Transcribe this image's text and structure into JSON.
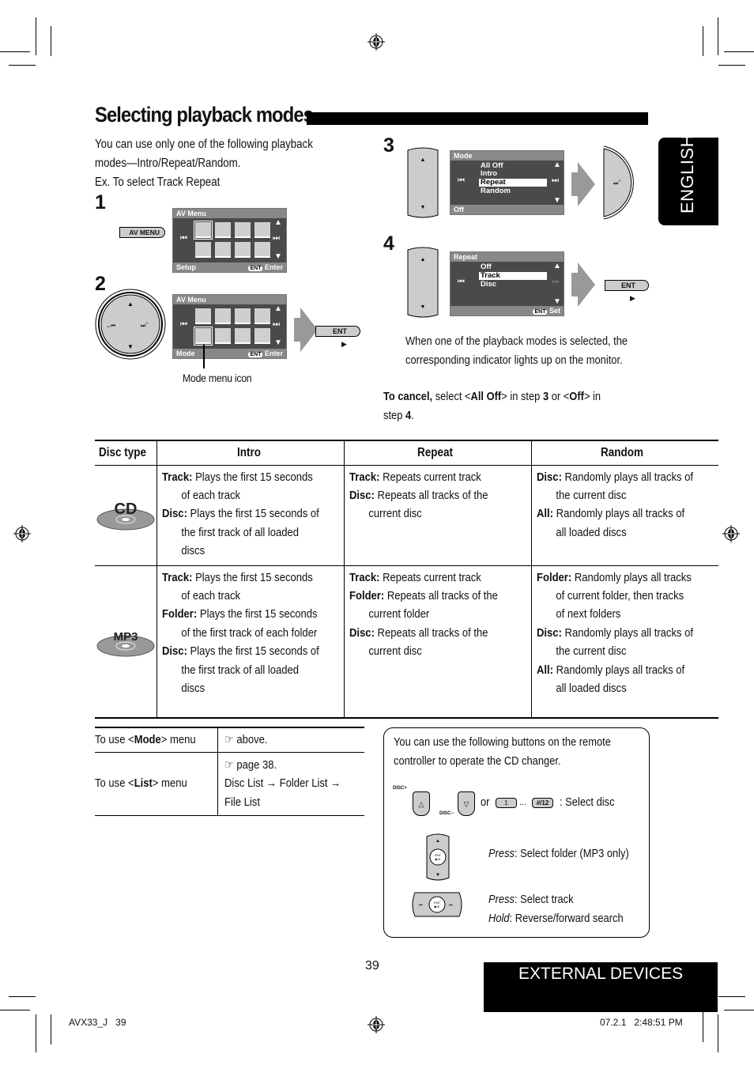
{
  "page": {
    "title": "Selecting playback modes",
    "intro_lines": [
      "You can use only one of the following playback",
      "modes—Intro/Repeat/Random.",
      "Ex. To select Track Repeat"
    ],
    "language_tab": "ENGLISH",
    "section_tab": "EXTERNAL DEVICES",
    "page_number": "39",
    "footer_left": "AVX33_J   39",
    "footer_right": "07.2.1   2:48:51 PM"
  },
  "steps": {
    "step1": {
      "number": "1",
      "button_label": "AV MENU",
      "screen": {
        "header": "AV Menu",
        "footer_left": "Setup",
        "footer_ent": "ENT",
        "footer_right": "Enter"
      }
    },
    "step2": {
      "number": "2",
      "screen": {
        "header": "AV Menu",
        "footer_left": "Mode",
        "footer_ent": "ENT",
        "footer_right": "Enter"
      },
      "button_label": "ENT",
      "callout": "Mode menu icon"
    },
    "step3": {
      "number": "3",
      "screen": {
        "header": "Mode",
        "items": [
          "All Off",
          "Intro",
          "Repeat",
          "Random"
        ],
        "selected": "Repeat",
        "footer_left": "Off"
      }
    },
    "step4": {
      "number": "4",
      "screen": {
        "header": "Repeat",
        "items": [
          "Off",
          "Track",
          "Disc"
        ],
        "selected": "Track",
        "footer_ent": "ENT",
        "footer_right": "Set"
      },
      "button_label": "ENT"
    },
    "note_lines": [
      "When one of the playback modes is selected, the",
      "corresponding indicator lights up on the monitor."
    ],
    "cancel": {
      "bold": "To cancel,",
      "t1": " select <",
      "b1": "All Off",
      "t2": "> in step ",
      "b2": "3",
      "t3": " or <",
      "b3": "Off",
      "t4": "> in",
      "t5": "step ",
      "b4": "4",
      "t6": "."
    }
  },
  "modes_table": {
    "headers": [
      "Disc type",
      "Intro",
      "Repeat",
      "Random"
    ],
    "rows": [
      {
        "disc": "CD",
        "intro": [
          {
            "k": "Track:",
            "v": " Plays the first 15 seconds of each track"
          },
          {
            "k": "Disc:",
            "v": " Plays the first 15 seconds of the first track of all loaded discs"
          }
        ],
        "repeat": [
          {
            "k": "Track:",
            "v": " Repeats current track"
          },
          {
            "k": "Disc:",
            "v": " Repeats all tracks of the current disc"
          }
        ],
        "random": [
          {
            "k": "Disc:",
            "v": " Randomly plays all tracks of the current disc"
          },
          {
            "k": "All:",
            "v": " Randomly plays all tracks of all loaded discs"
          }
        ]
      },
      {
        "disc": "MP3",
        "intro": [
          {
            "k": "Track:",
            "v": " Plays the first 15 seconds of each track"
          },
          {
            "k": "Folder:",
            "v": " Plays the first 15 seconds of the first track of each folder"
          },
          {
            "k": "Disc:",
            "v": " Plays the first 15 seconds of the first track of all loaded discs"
          }
        ],
        "repeat": [
          {
            "k": "Track:",
            "v": " Repeats current track"
          },
          {
            "k": "Folder:",
            "v": " Repeats all tracks of the current folder"
          },
          {
            "k": "Disc:",
            "v": " Repeats all tracks of the current disc"
          }
        ],
        "random": [
          {
            "k": "Folder:",
            "v": " Randomly plays all tracks of current folder, then tracks of next folders"
          },
          {
            "k": "Disc:",
            "v": " Randomly plays all tracks of the current disc"
          },
          {
            "k": "All:",
            "v": " Randomly plays all tracks of all loaded discs"
          }
        ]
      }
    ]
  },
  "menu_table": {
    "row1": {
      "pre": "To use <",
      "b": "Mode",
      "post": "> menu",
      "ref": "☞ above."
    },
    "row2": {
      "pre": "To use <",
      "b": "List",
      "post": "> menu",
      "ref": "☞ page 38.",
      "path1": "Disc List → Folder List →",
      "path2": "File List"
    }
  },
  "remote_box": {
    "intro_lines": [
      "You can use the following buttons on the remote",
      "controller to operate the CD changer."
    ],
    "disc_plus": "DISC+",
    "disc_minus": "DISC−",
    "or": "or",
    "btn_1": "1",
    "ellipsis": "...",
    "btn_12": "#/12",
    "select_disc": ": Select disc",
    "folder": {
      "em": "Press",
      "text": ": Select folder (MP3 only)"
    },
    "track": {
      "em": "Press",
      "text": ": Select track"
    },
    "search": {
      "em": "Hold",
      "text": ": Reverse/forward search"
    },
    "ent_label": "ENT"
  }
}
